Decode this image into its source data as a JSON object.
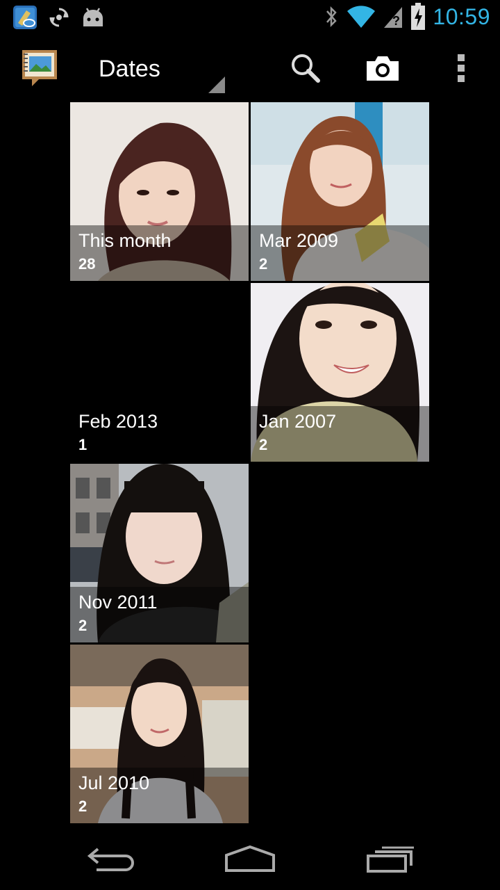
{
  "status_bar": {
    "time": "10:59",
    "left_icons": [
      "intel-app-icon",
      "sync-icon",
      "android-icon"
    ],
    "right_icons": [
      "bluetooth-icon",
      "wifi-icon",
      "signal-icon",
      "battery-charging-icon"
    ],
    "accent_color": "#33b5e5"
  },
  "action_bar": {
    "spinner_label": "Dates",
    "actions": [
      "search-icon",
      "camera-icon",
      "overflow-menu-icon"
    ]
  },
  "albums": [
    {
      "title": "This month",
      "count": "28"
    },
    {
      "title": "Mar 2009",
      "count": "2"
    },
    {
      "title": "Feb 2013",
      "count": "1"
    },
    {
      "title": "Jan 2007",
      "count": "2"
    },
    {
      "title": "Nov 2011",
      "count": "2"
    },
    {
      "title": "Jul 2010",
      "count": "2"
    }
  ],
  "nav_bar": {
    "buttons": [
      "back-icon",
      "home-icon",
      "recent-apps-icon"
    ]
  }
}
